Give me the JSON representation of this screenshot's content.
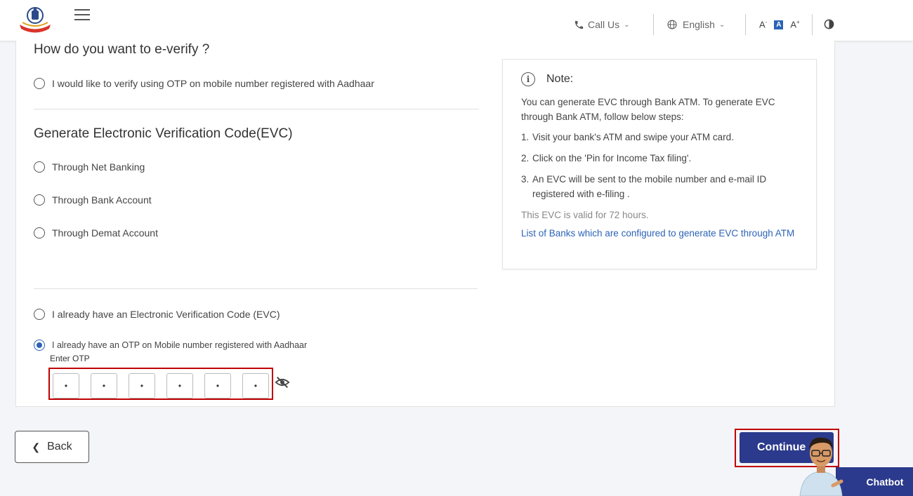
{
  "header": {
    "call_us": "Call Us",
    "language": "English",
    "font_decrease": "A",
    "font_normal": "A",
    "font_increase": "A"
  },
  "main": {
    "question": "How do you want to e-verify ?",
    "option_aadhaar_otp": "I would like to verify using OTP on mobile number registered with Aadhaar",
    "section_title": "Generate Electronic Verification Code(EVC)",
    "option_net_banking": "Through Net Banking",
    "option_bank_account": "Through Bank Account",
    "option_demat_account": "Through Demat Account",
    "option_have_evc": "I already have an Electronic Verification Code (EVC)",
    "option_have_otp": "I already have an OTP on Mobile number registered with Aadhaar",
    "selected_option": "option_have_otp",
    "enter_otp_label": "Enter OTP",
    "otp_digits": [
      "•",
      "•",
      "•",
      "•",
      "•",
      "•"
    ]
  },
  "note": {
    "title": "Note:",
    "intro": "You can generate EVC through Bank ATM. To generate EVC through Bank ATM, follow below steps:",
    "steps": [
      {
        "num": "1.",
        "text": "Visit your bank's ATM and swipe your ATM card."
      },
      {
        "num": "2.",
        "text": "Click on the 'Pin for Income Tax filing'."
      },
      {
        "num": "3.",
        "text": "An EVC will be sent to the mobile number and e-mail ID registered with e-filing ."
      }
    ],
    "validity": "This EVC is valid for 72 hours.",
    "link": "List of Banks which are configured to generate EVC through ATM"
  },
  "footer": {
    "back_label": "Back",
    "continue_label": "Continue",
    "chatbot_label": "Chatbot"
  },
  "colors": {
    "primary": "#2b3a8c",
    "link": "#2c63b6",
    "highlight": "#c00000"
  }
}
